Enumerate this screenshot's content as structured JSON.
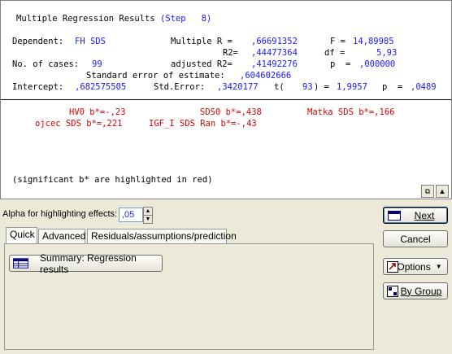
{
  "results": {
    "title": "Multiple Regression Results",
    "step": "(Step   8)",
    "dependent_label": "Dependent:",
    "dependent_value": "FH SDS",
    "multiple_r_label": "Multiple R =",
    "multiple_r_value": ",66691352",
    "f_label": "F =",
    "f_value": "14,89985",
    "r2_label": "R2=",
    "r2_value": ",44477364",
    "df_label": "df =",
    "df_value": "5,93",
    "cases_label": "No. of cases:",
    "cases_value": "99",
    "adj_r2_label": "adjusted R2=",
    "adj_r2_value": ",41492276",
    "p_label": "p  =",
    "p_value": ",000000",
    "std_err_est_label": "Standard error of estimate:",
    "std_err_est_value": ",604602666",
    "intercept_label": "Intercept:",
    "intercept_value": ",682575505",
    "std_error_label": "Std.Error:",
    "std_error_value": ",3420177",
    "t_label": "t(",
    "t_df": "93",
    "t_eq": ") =",
    "t_value": "1,9957",
    "p2_label": "p  =",
    "p2_value": ",0489",
    "effects": [
      "HV0 b*=-,23",
      "SDS0 b*=,438",
      "Matka SDS b*=,166",
      "ojcec SDS b*=,221",
      "IGF_I SDS Ran b*=-,43"
    ],
    "footnote": "(significant b* are highlighted in red)"
  },
  "alpha": {
    "label": "Alpha for highlighting effects:",
    "value": ",05"
  },
  "tabs": [
    {
      "label": "Quick"
    },
    {
      "label": "Advanced"
    },
    {
      "label": "Residuals/assumptions/prediction"
    }
  ],
  "buttons": {
    "summary": "Summary:  Regression results",
    "next": "Next",
    "cancel": "Cancel",
    "options": "Options",
    "by_group": "By Group"
  },
  "colors": {
    "highlight_red": "#e00000",
    "value_blue": "#1a1aff",
    "dialog_bg": "#ece9d8"
  }
}
